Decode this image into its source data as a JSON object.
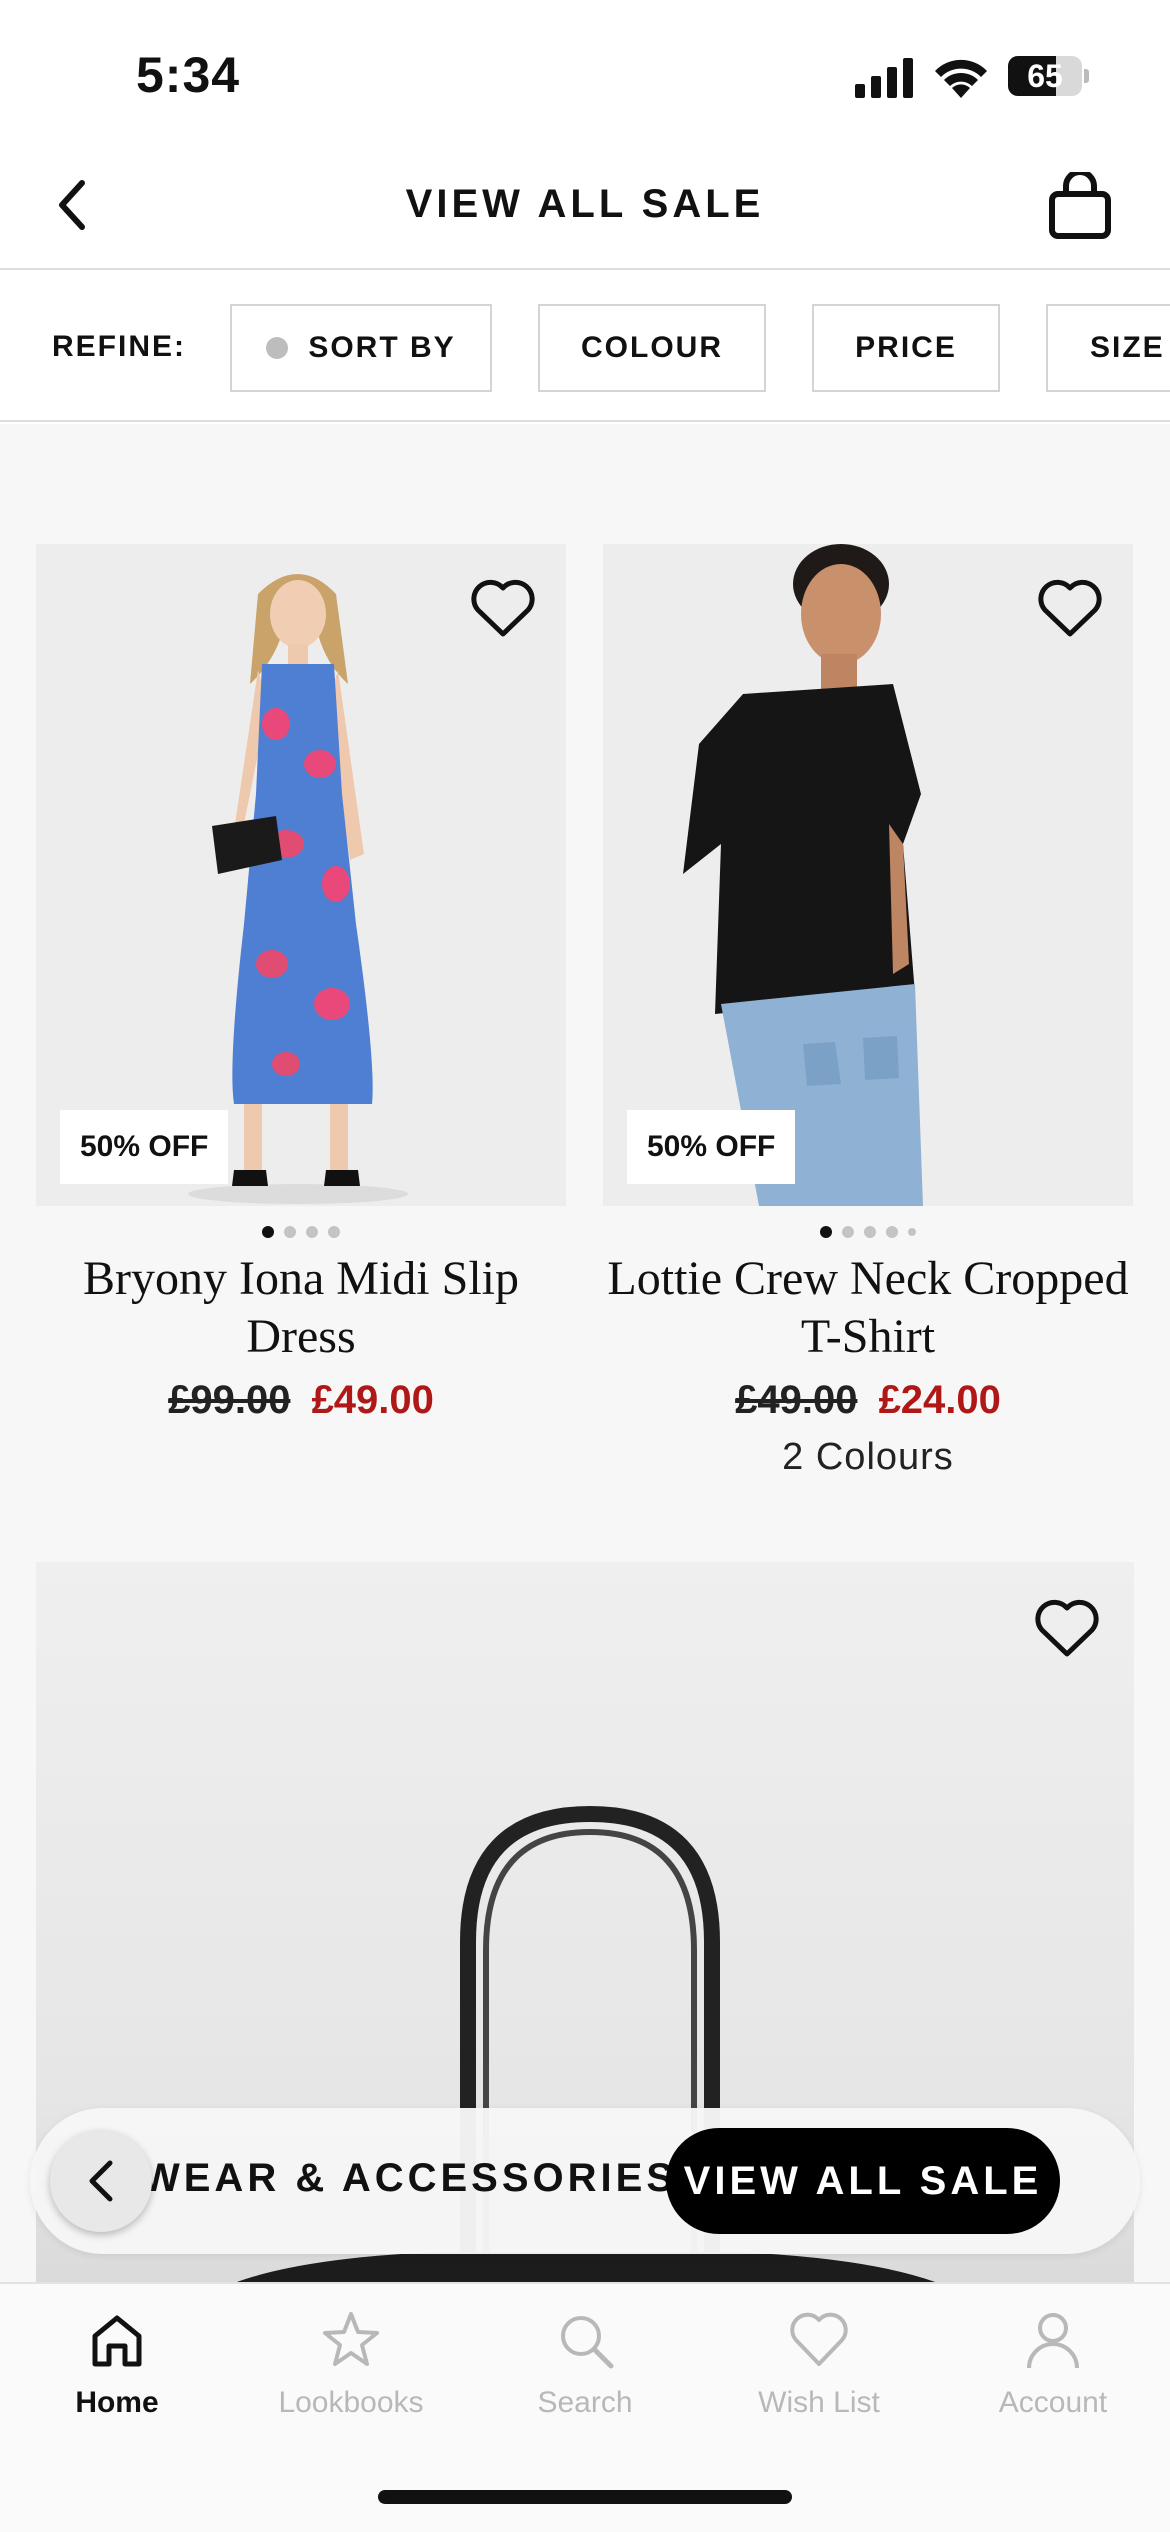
{
  "status_bar": {
    "time": "5:34",
    "battery": "65",
    "battery_level": 0.65
  },
  "header": {
    "title": "VIEW ALL SALE",
    "back_icon": "chevron-left-icon",
    "bag_icon": "shopping-bag-icon"
  },
  "refine": {
    "label": "REFINE:",
    "chips": [
      {
        "label": "SORT BY",
        "has_indicator": true
      },
      {
        "label": "COLOUR"
      },
      {
        "label": "PRICE"
      },
      {
        "label": "SIZE"
      }
    ]
  },
  "products": [
    {
      "name": "Bryony Iona Midi Slip Dress",
      "badge": "50% OFF",
      "old_price": "£99.00",
      "new_price": "£49.00",
      "image_count": 4,
      "active_image": 1
    },
    {
      "name": "Lottie Crew Neck Cropped T-Shirt",
      "badge": "50% OFF",
      "old_price": "£49.00",
      "new_price": "£24.00",
      "colours": "2 Colours",
      "image_count": 5,
      "active_image": 1
    }
  ],
  "breadcrumb": {
    "previous": "WEAR & ACCESSORIES",
    "current": "VIEW ALL SALE"
  },
  "tab_bar": {
    "tabs": [
      {
        "label": "Home",
        "icon": "home-icon",
        "active": true
      },
      {
        "label": "Lookbooks",
        "icon": "star-icon"
      },
      {
        "label": "Search",
        "icon": "search-icon"
      },
      {
        "label": "Wish List",
        "icon": "heart-icon"
      },
      {
        "label": "Account",
        "icon": "person-icon"
      }
    ]
  },
  "colors": {
    "sale_red": "#b01818",
    "text": "#111111",
    "inactive_tab": "#b8b8b8"
  }
}
